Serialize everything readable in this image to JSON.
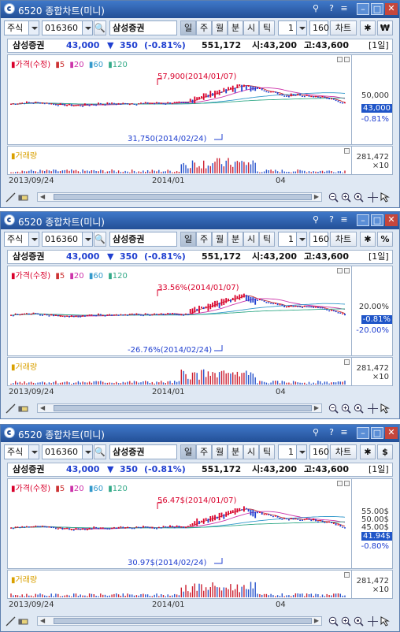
{
  "colors": {
    "up": "#d9002b",
    "down": "#1f3fd0",
    "ma5": "#cc3333",
    "ma20": "#cc33aa",
    "ma60": "#3399cc",
    "ma120": "#33aa88",
    "volume": "#cc2233",
    "volume_down": "#2a55cc"
  },
  "windows": [
    {
      "title": "6520 종합차트(미니)",
      "toolbar": {
        "market": "주식",
        "code": "016360",
        "name": "삼성증권",
        "periods": [
          "일",
          "주",
          "월",
          "분",
          "시",
          "틱"
        ],
        "selected_period": "일",
        "interval": "1",
        "count": "160",
        "chart_btn": "차트",
        "unit_btn": "₩"
      },
      "info": {
        "name": "삼성증권",
        "price": "43,000",
        "arrow": "▼",
        "change": "350",
        "pct": "(-0.81%)",
        "volume": "551,172",
        "open": "시:43,200",
        "high": "고:43,600",
        "range": "[1일]"
      },
      "legend": {
        "price": "가격(수정)",
        "ma": [
          "5",
          "20",
          "60",
          "120"
        ]
      },
      "high_label": "57,900(2014/01/07)",
      "low_label": "31,750(2014/02/24)",
      "yaxis": [
        "50,000",
        "43,000",
        "-0.81%"
      ],
      "current_label": "43,000",
      "volume_label": "거래량",
      "volume_axis": "281,472",
      "volume_mult": "×10",
      "xaxis": [
        "2013/09/24",
        "2014/01",
        "04"
      ]
    },
    {
      "title": "6520 종합차트(미니)",
      "toolbar": {
        "market": "주식",
        "code": "016360",
        "name": "삼성증권",
        "periods": [
          "일",
          "주",
          "월",
          "분",
          "시",
          "틱"
        ],
        "selected_period": "일",
        "interval": "1",
        "count": "160",
        "chart_btn": "차트",
        "unit_btn": "%"
      },
      "info": {
        "name": "삼성증권",
        "price": "43,000",
        "arrow": "▼",
        "change": "350",
        "pct": "(-0.81%)",
        "volume": "551,172",
        "open": "시:43,200",
        "high": "고:43,600",
        "range": "[1일]"
      },
      "legend": {
        "price": "가격(수정)",
        "ma": [
          "5",
          "20",
          "60",
          "120"
        ]
      },
      "high_label": "33.56%(2014/01/07)",
      "low_label": "-26.76%(2014/02/24)",
      "yaxis": [
        "20.00%",
        "-0.81%",
        "-20.00%"
      ],
      "current_label": "-0.81%",
      "volume_label": "거래량",
      "volume_axis": "281,472",
      "volume_mult": "×10",
      "xaxis": [
        "2013/09/24",
        "2014/01",
        "04"
      ]
    },
    {
      "title": "6520 종합차트(미니)",
      "toolbar": {
        "market": "주식",
        "code": "016360",
        "name": "삼성증권",
        "periods": [
          "일",
          "주",
          "월",
          "분",
          "시",
          "틱"
        ],
        "selected_period": "일",
        "interval": "1",
        "count": "160",
        "chart_btn": "차트",
        "unit_btn": "$"
      },
      "info": {
        "name": "삼성증권",
        "price": "43,000",
        "arrow": "▼",
        "change": "350",
        "pct": "(-0.81%)",
        "volume": "551,172",
        "open": "시:43,200",
        "high": "고:43,600",
        "range": "[1일]"
      },
      "legend": {
        "price": "가격(수정)",
        "ma": [
          "5",
          "20",
          "60",
          "120"
        ]
      },
      "high_label": "56.47$(2014/01/07)",
      "low_label": "30.97$(2014/02/24)",
      "yaxis": [
        "55.00$",
        "50.00$",
        "45.00$",
        "41.94$",
        "-0.80%"
      ],
      "current_label": "41.94$",
      "volume_label": "거래량",
      "volume_axis": "281,472",
      "volume_mult": "×10",
      "xaxis": [
        "2013/09/24",
        "2014/01",
        "04"
      ]
    }
  ]
}
